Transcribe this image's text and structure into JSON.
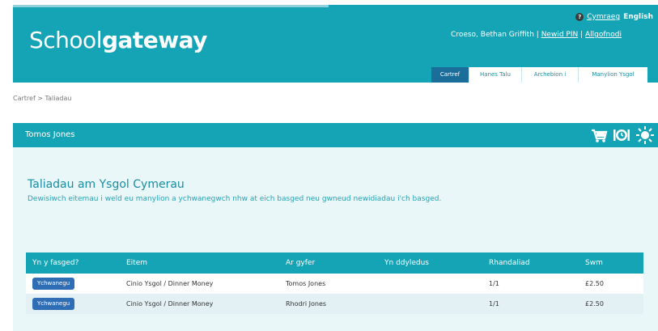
{
  "app": {
    "logo_part1": "Sch",
    "logo_oo": "oo",
    "logo_part2": "l",
    "logo_part3": "gateway"
  },
  "lang": {
    "help_icon": "help-icon",
    "cymraeg": "Cymraeg",
    "english": "English"
  },
  "user": {
    "greeting": "Croeso, Bethan Griffith |",
    "change_pin": "Newid PIN",
    "sep": "|",
    "logout": "Allgofnodi"
  },
  "tabs": [
    {
      "label": "Cartref",
      "active": true
    },
    {
      "label": "Hanes Talu",
      "active": false
    },
    {
      "label": "Archebion i",
      "active": false
    },
    {
      "label": "Manylion Ysgol",
      "active": false
    }
  ],
  "breadcrumb": "Cartref  >  Taliadau",
  "panel": {
    "student_name": "Tomos Jones",
    "icons": [
      "basket-icon",
      "clock-icon",
      "sun-icon"
    ],
    "title": "Taliadau am Ysgol Cymerau",
    "description": "Dewisiwch eitemau i weld eu manylion a ychwanegwch nhw at eich basged neu gwneud newidiadau i'ch basged."
  },
  "table": {
    "headers": [
      "Yn y fasged?",
      "Eitem",
      "Ar gyfer",
      "Yn ddyledus",
      "Rhandaliad",
      "Swm"
    ],
    "rows": [
      {
        "button": "Ychwanegu",
        "item": "Cinio Ysgol / Dinner Money",
        "for": "Tomos Jones",
        "due": "",
        "installment": "1/1",
        "amount": "£2.50"
      },
      {
        "button": "Ychwanegu",
        "item": "Cinio Ysgol / Dinner Money",
        "for": "Rhodri Jones",
        "due": "",
        "installment": "1/1",
        "amount": "£2.50"
      }
    ]
  },
  "colors": {
    "brand_teal": "#14a4b6",
    "active_tab": "#1c6e9a",
    "button_blue": "#2f6db5",
    "panel_bg": "#e9f7f9"
  }
}
